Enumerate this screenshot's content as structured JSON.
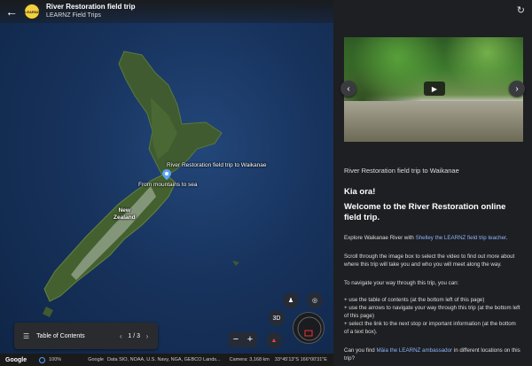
{
  "header": {
    "back_icon": "arrow-left-icon",
    "logo_text": "LEARNZ",
    "title": "River Restoration field trip",
    "subtitle": "LEARNZ Field Trips"
  },
  "map": {
    "pin_label": "River Restoration field trip to Waikanae",
    "sub_label": "From mountains to sea",
    "country_label_1": "New",
    "country_label_2": "Zealand"
  },
  "toc": {
    "label": "Table of Contents",
    "page": "1 / 3",
    "prev_icon": "chevron-left-icon",
    "next_icon": "chevron-right-icon"
  },
  "controls": {
    "view_3d": "3D",
    "zoom_out": "−",
    "zoom_in": "+",
    "person_icon": "pegman-icon",
    "locate_icon": "my-location-icon",
    "north_icon": "compass-north-icon"
  },
  "status": {
    "brand": "Google",
    "zoom": "100%",
    "attribution_brand": "Google",
    "attribution": "Data SIO, NOAA, U.S. Navy, NGA, GEBCO  Lands...",
    "camera": "Camera: 3,168 km",
    "coords": "33°45'13\"S 166°00'31\"E"
  },
  "panel": {
    "refresh_icon": "refresh-icon",
    "prev_icon": "chevron-left-icon",
    "next_icon": "chevron-right-icon",
    "play_icon": "play-icon",
    "stop_title": "River Restoration field trip to Waikanae",
    "greeting": "Kia ora!",
    "welcome": "Welcome to the River Restoration online field trip.",
    "p1_before": "Explore Waikanae River with ",
    "p1_link": "Shelley the LEARNZ field trip teacher",
    "p1_after": ".",
    "p2": "Scroll through the image box to select the video to find out more about where this trip will take you and who you will meet along the way.",
    "p3": "To navigate your way through this trip, you can:",
    "bullet1": "+ use the table of contents (at the bottom left of this page)",
    "bullet2": "+ use the arrows to navigate your way through this trip (at the bottom left of this page)",
    "bullet3": "+ select the link to the next stop or important information (at the bottom of a text box).",
    "p4_before": "Can you find ",
    "p4_link": "Māia the LEARNZ ambassador",
    "p4_after": " in different locations on this trip?"
  }
}
